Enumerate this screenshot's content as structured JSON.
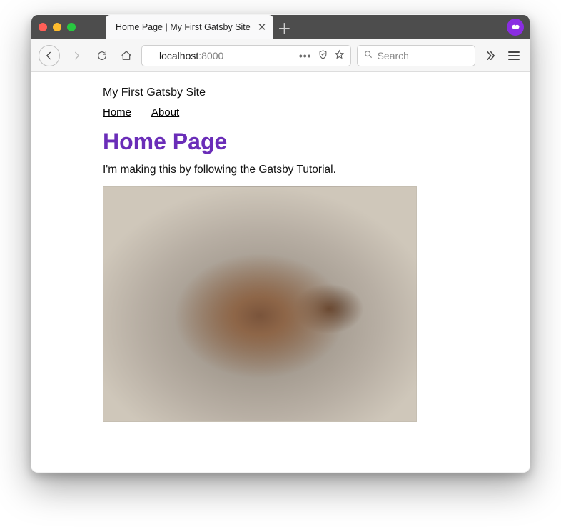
{
  "window": {
    "tab_title": "Home Page | My First Gatsby Site"
  },
  "toolbar": {
    "url_host": "localhost",
    "url_rest": ":8000",
    "search_placeholder": "Search"
  },
  "site": {
    "title": "My First Gatsby Site",
    "nav": {
      "home": "Home",
      "about": "About"
    }
  },
  "content": {
    "heading": "Home Page",
    "paragraph": "I'm making this by following the Gatsby Tutorial.",
    "heading_color": "#6a2db8"
  }
}
